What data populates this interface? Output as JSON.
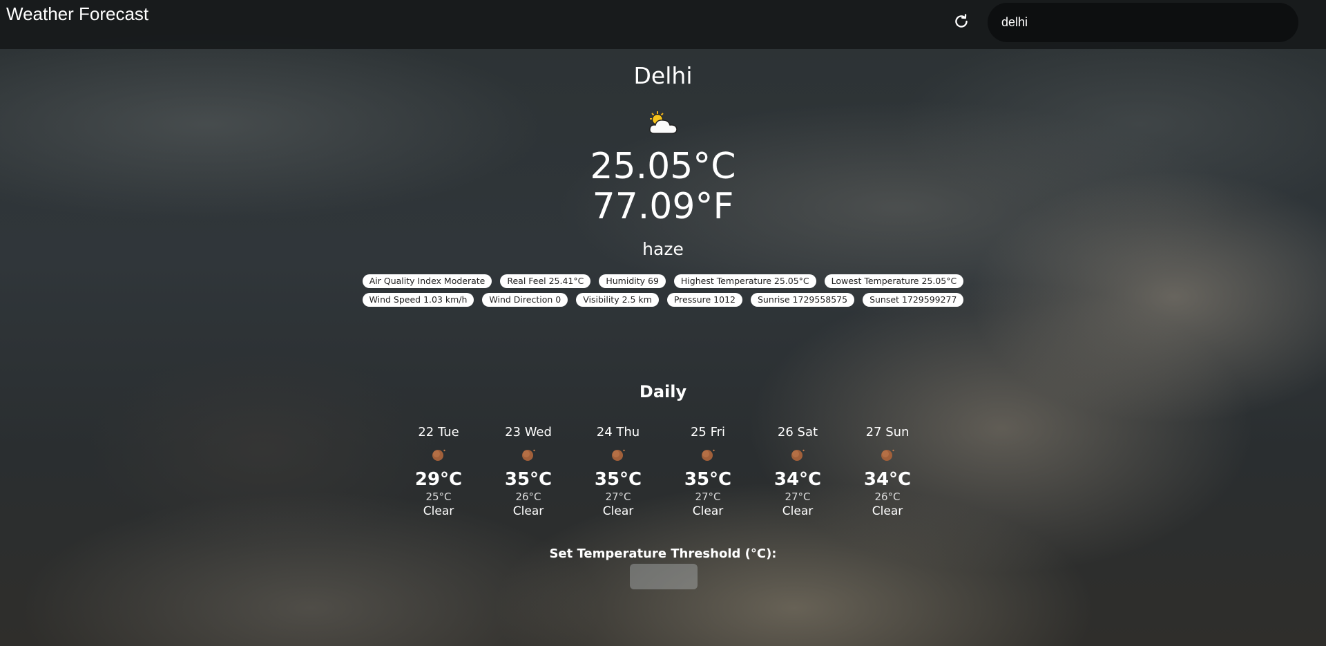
{
  "header": {
    "title": "Weather Forecast",
    "refresh_icon": "refresh-icon",
    "search_value": "delhi"
  },
  "current": {
    "city": "Delhi",
    "icon": "sun-behind-cloud-icon",
    "temp_c": "25.05°C",
    "temp_f": "77.09°F",
    "description": "haze"
  },
  "details": {
    "row1": [
      "Air Quality Index Moderate",
      "Real Feel 25.41°C",
      "Humidity 69",
      "Highest Temperature 25.05°C",
      "Lowest Temperature 25.05°C"
    ],
    "row2": [
      "Wind Speed 1.03 km/h",
      "Wind Direction 0",
      "Visibility 2.5 km",
      "Pressure 1012",
      "Sunrise 1729558575",
      "Sunset 1729599277"
    ]
  },
  "daily": {
    "title": "Daily",
    "days": [
      {
        "label": "22 Tue",
        "max": "29°C",
        "min": "25°C",
        "desc": "Clear",
        "icon": "clear-sun-icon"
      },
      {
        "label": "23 Wed",
        "max": "35°C",
        "min": "26°C",
        "desc": "Clear",
        "icon": "clear-sun-icon"
      },
      {
        "label": "24 Thu",
        "max": "35°C",
        "min": "27°C",
        "desc": "Clear",
        "icon": "clear-sun-icon"
      },
      {
        "label": "25 Fri",
        "max": "35°C",
        "min": "27°C",
        "desc": "Clear",
        "icon": "clear-sun-icon"
      },
      {
        "label": "26 Sat",
        "max": "34°C",
        "min": "27°C",
        "desc": "Clear",
        "icon": "clear-sun-icon"
      },
      {
        "label": "27 Sun",
        "max": "34°C",
        "min": "26°C",
        "desc": "Clear",
        "icon": "clear-sun-icon"
      }
    ]
  },
  "threshold": {
    "label": "Set Temperature Threshold (°C):",
    "value": ""
  },
  "colors": {
    "header_bg": "#141617",
    "search_bg": "#0d0f10",
    "pill_bg": "#ffffff",
    "pill_text": "#222222"
  }
}
